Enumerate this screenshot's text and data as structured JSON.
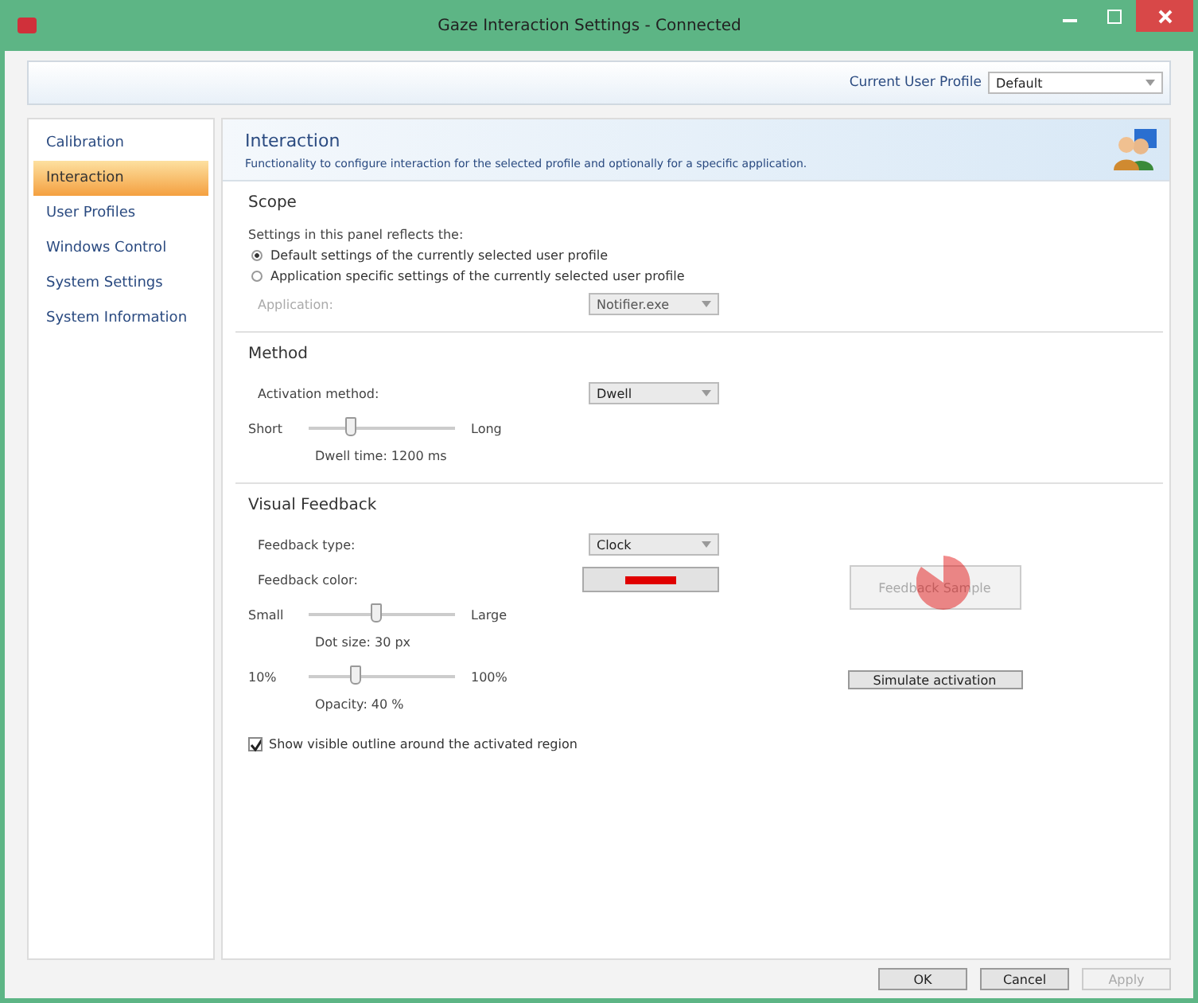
{
  "window": {
    "title": "Gaze Interaction Settings - Connected"
  },
  "profile": {
    "label": "Current User Profile",
    "value": "Default"
  },
  "sidebar": {
    "items": [
      {
        "label": "Calibration",
        "selected": false
      },
      {
        "label": "Interaction",
        "selected": true
      },
      {
        "label": "User Profiles",
        "selected": false
      },
      {
        "label": "Windows Control",
        "selected": false
      },
      {
        "label": "System Settings",
        "selected": false
      },
      {
        "label": "System Information",
        "selected": false
      }
    ]
  },
  "header": {
    "title": "Interaction",
    "description": "Functionality to configure interaction for the selected profile and optionally for a specific application."
  },
  "scope": {
    "title": "Scope",
    "intro": "Settings in this panel reflects the:",
    "options": [
      {
        "label": "Default settings of the currently selected user profile",
        "selected": true
      },
      {
        "label": "Application specific settings of the currently selected user profile",
        "selected": false
      }
    ],
    "application": {
      "label": "Application:",
      "value": "Notifier.exe",
      "disabled": true
    }
  },
  "method": {
    "title": "Method",
    "activation": {
      "label": "Activation method:",
      "value": "Dwell"
    },
    "slider": {
      "min_label": "Short",
      "max_label": "Long",
      "level": 0.28,
      "reading": "Dwell time: 1200 ms"
    }
  },
  "feedback": {
    "title": "Visual Feedback",
    "type": {
      "label": "Feedback type:",
      "value": "Clock"
    },
    "color": {
      "label": "Feedback color:",
      "color": "#e00000"
    },
    "sliders": [
      {
        "min_label": "Small",
        "max_label": "Large",
        "level": 0.46,
        "reading": "Dot size: 30 px"
      },
      {
        "min_label": "10%",
        "max_label": "100%",
        "level": 0.32,
        "reading": "Opacity: 40 %"
      }
    ],
    "outline": {
      "label": "Show visible outline around the activated region",
      "checked": true
    },
    "sample": {
      "label": "Feedback Sample",
      "disabled": true
    },
    "simulate": {
      "label": "Simulate activation",
      "disabled": false
    }
  },
  "buttons": [
    {
      "label": "OK",
      "disabled": false
    },
    {
      "label": "Cancel",
      "disabled": false
    },
    {
      "label": "Apply",
      "disabled": true
    }
  ]
}
